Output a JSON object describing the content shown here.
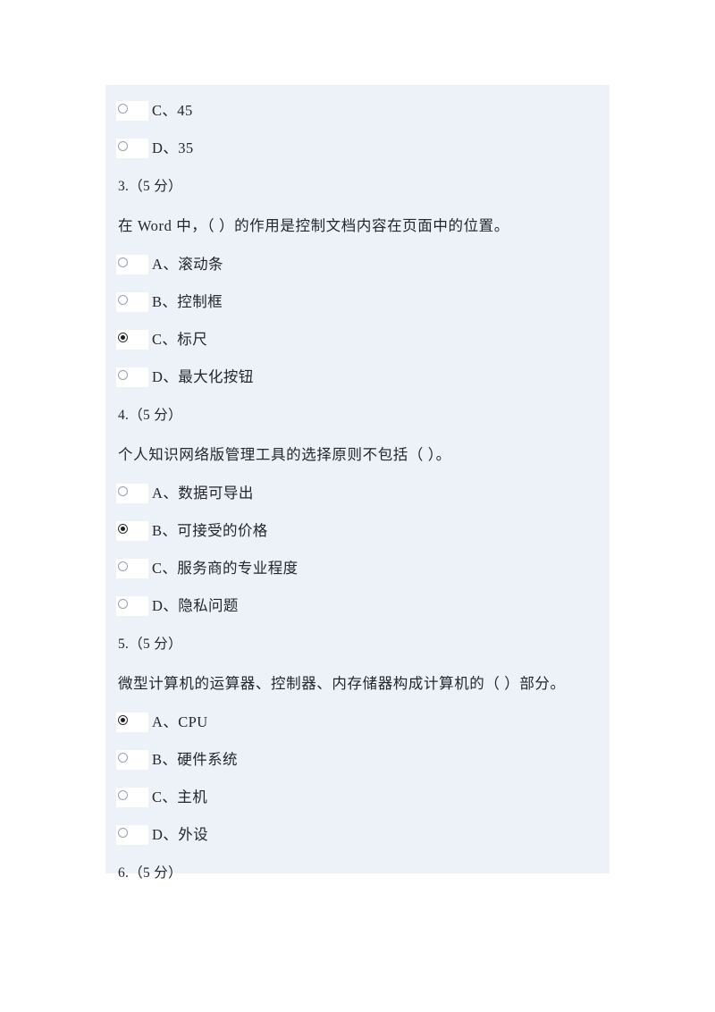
{
  "document": {
    "type": "online-quiz-printout",
    "panel_background": "#edf1f8",
    "page_background": "#ffffff",
    "text_color": "#24262b"
  },
  "leading_options": [
    {
      "marker": "C、45",
      "selected": false
    },
    {
      "marker": "D、35",
      "selected": false
    }
  ],
  "questions": [
    {
      "number": "3.（5 分）",
      "text": "在 Word 中，（ ）的作用是控制文档内容在页面中的位置。",
      "options": [
        {
          "label": "A、滚动条",
          "selected": false
        },
        {
          "label": "B、控制框",
          "selected": false
        },
        {
          "label": "C、标尺",
          "selected": true
        },
        {
          "label": "D、最大化按钮",
          "selected": false
        }
      ]
    },
    {
      "number": "4.（5 分）",
      "text": "个人知识网络版管理工具的选择原则不包括（ ）。",
      "options": [
        {
          "label": "A、数据可导出",
          "selected": false
        },
        {
          "label": "B、可接受的价格",
          "selected": true
        },
        {
          "label": "C、服务商的专业程度",
          "selected": false
        },
        {
          "label": "D、隐私问题",
          "selected": false
        }
      ]
    },
    {
      "number": "5.（5 分）",
      "text": "微型计算机的运算器、控制器、内存储器构成计算机的（ ）部分。",
      "options": [
        {
          "label": "A、CPU",
          "selected": true
        },
        {
          "label": "B、硬件系统",
          "selected": false
        },
        {
          "label": "C、主机",
          "selected": false
        },
        {
          "label": "D、外设",
          "selected": false
        }
      ]
    }
  ],
  "trailing_question": {
    "number": "6.（5 分）"
  }
}
